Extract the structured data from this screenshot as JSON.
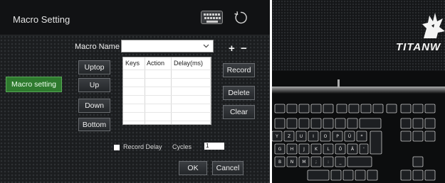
{
  "window": {
    "title": "Macro Setting"
  },
  "header_icons": {
    "keyboard": "keyboard-icon",
    "reset": "refresh-icon"
  },
  "macro": {
    "name_label": "Macro Name",
    "name_value": "",
    "add_label": "+",
    "remove_label": "−",
    "tab_label": "Macro setting"
  },
  "move_buttons": {
    "uptop": "Uptop",
    "up": "Up",
    "down": "Down",
    "bottom": "Bottom"
  },
  "table": {
    "columns": [
      "Keys",
      "Action",
      "Delay(ms)"
    ],
    "rows": []
  },
  "action_buttons": {
    "record": "Record",
    "delete": "Delete",
    "clear": "Clear"
  },
  "options": {
    "record_delay_label": "Record Delay",
    "record_delay_checked": false,
    "cycles_label": "Cycles",
    "cycles_value": "1"
  },
  "footer": {
    "ok": "OK",
    "cancel": "Cancel"
  },
  "photo": {
    "brand": "TITANW",
    "logo": "wolf-logo-icon",
    "key_legends": [
      [
        "Y",
        "Z",
        "U",
        "I",
        "O",
        "P",
        "Ü",
        "*"
      ],
      [
        "G",
        "H",
        "J",
        "K",
        "L",
        "Ö",
        "Ä",
        "'"
      ],
      [
        "B",
        "N",
        "M",
        ";",
        ":",
        "_"
      ]
    ]
  },
  "colors": {
    "accent_green": "#2e7a2e",
    "panel_bg": "#1b1d1f"
  }
}
